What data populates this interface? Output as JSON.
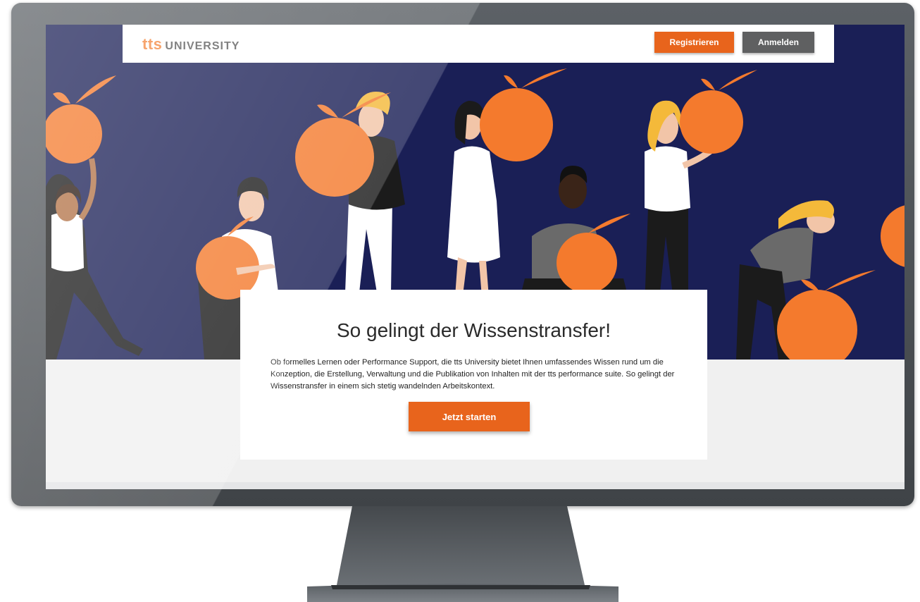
{
  "header": {
    "logo_tts": "tts",
    "logo_university": "UNIVERSITY",
    "register_label": "Registrieren",
    "login_label": "Anmelden"
  },
  "hero": {
    "title": "So gelingt der Wissenstransfer!",
    "text": "Ob formelles Lernen oder Performance Support, die tts University bietet Ihnen umfassendes Wissen rund um die Konzeption, die Erstellung, Verwaltung und die Publikation von Inhalten mit der tts performance suite. So gelingt der Wissenstransfer in einem sich stetig wandelnden Arbeitskontext.",
    "cta_label": "Jetzt starten"
  },
  "colors": {
    "accent": "#e8641c",
    "hero_background": "#1a1f56",
    "login_button": "#5f6061",
    "orange_fruit": "#f47a2d"
  }
}
